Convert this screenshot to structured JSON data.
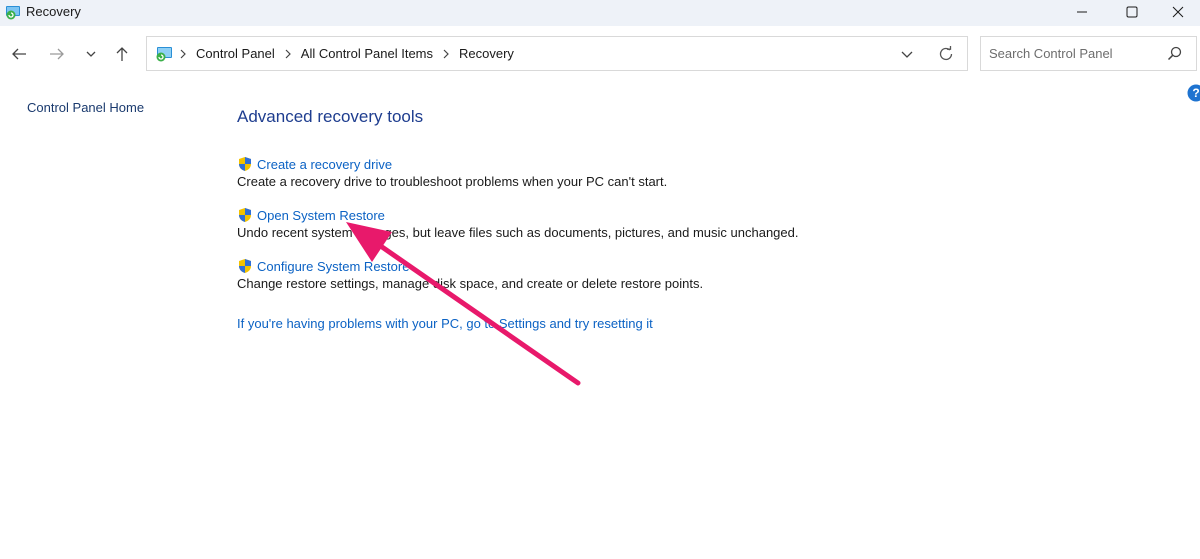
{
  "window": {
    "title": "Recovery",
    "icons": {
      "app": "recovery-icon",
      "minimize": "minimize-icon",
      "maximize": "maximize-icon",
      "close": "close-icon"
    }
  },
  "nav": {
    "icons": {
      "back": "arrow-left-icon",
      "forward": "arrow-right-icon",
      "recent": "chevron-down-icon",
      "up": "arrow-up-icon"
    }
  },
  "address": {
    "icon": "control-panel-icon",
    "crumbs": [
      "Control Panel",
      "All Control Panel Items",
      "Recovery"
    ],
    "dropdown_icon": "chevron-down-icon",
    "refresh_icon": "refresh-icon"
  },
  "search": {
    "placeholder": "Search Control Panel",
    "icon": "search-icon"
  },
  "sidebar": {
    "home_link": "Control Panel Home"
  },
  "help": {
    "icon": "help-icon"
  },
  "main": {
    "section_title": "Advanced recovery tools",
    "tasks": [
      {
        "label": "Create a recovery drive",
        "description": "Create a recovery drive to troubleshoot problems when your PC can't start.",
        "icon": "shield-icon"
      },
      {
        "label": "Open System Restore",
        "description": "Undo recent system changes, but leave files such as documents, pictures, and music unchanged.",
        "icon": "shield-icon"
      },
      {
        "label": "Configure System Restore",
        "description": "Change restore settings, manage disk space, and create or delete restore points.",
        "icon": "shield-icon"
      }
    ],
    "reset_link": "If you're having problems with your PC, go to Settings and try resetting it"
  },
  "annotation": {
    "color": "#e8196b",
    "points_to": "Open System Restore",
    "icon": "pink-arrow-icon"
  }
}
